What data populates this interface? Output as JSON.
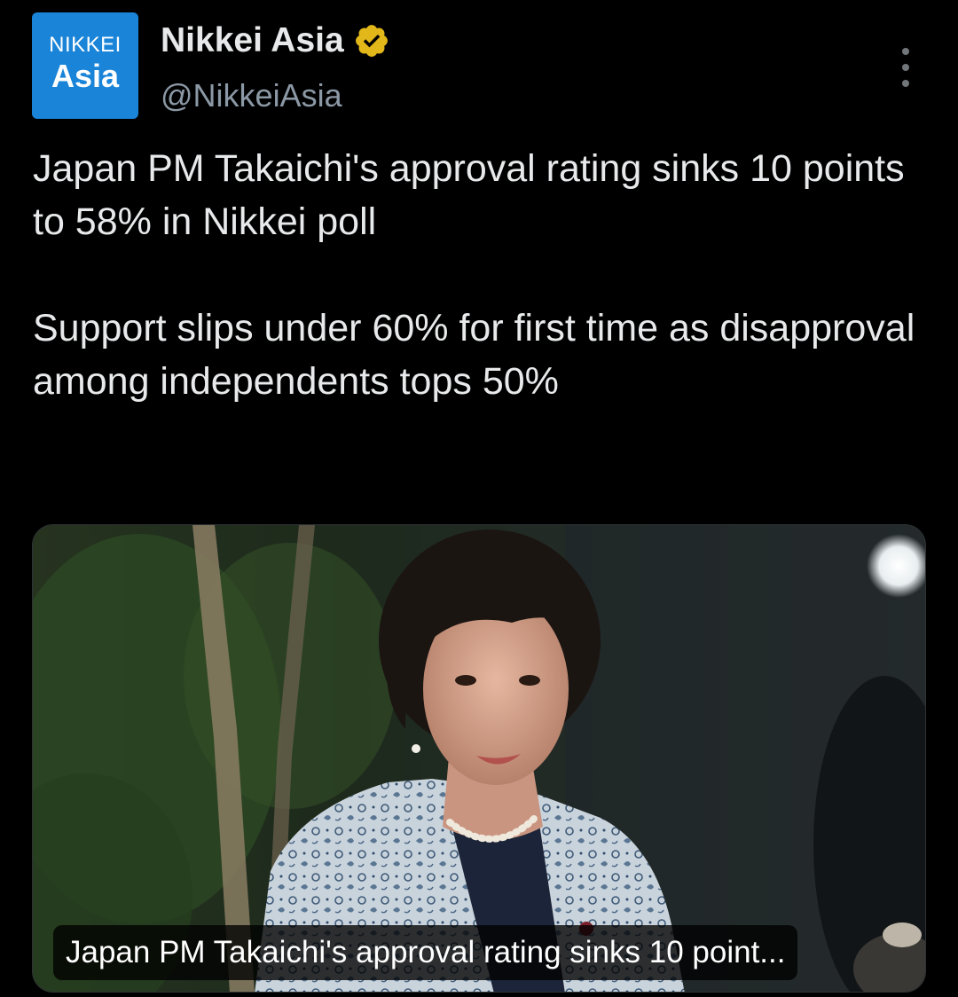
{
  "account": {
    "avatar_line1": "NIKKEI",
    "avatar_line2": "Asia",
    "display_name": "Nikkei Asia",
    "handle": "@NikkeiAsia",
    "verified": true
  },
  "tweet": {
    "headline": "Japan PM Takaichi's approval rating sinks 10 points to 58% in Nikkei poll",
    "subhead": "Support slips under 60% for first time as disapproval among independents tops 50%"
  },
  "card": {
    "caption": "Japan PM Takaichi's approval rating sinks 10 point..."
  },
  "icons": {
    "verified": "verified-badge-icon",
    "more": "more-options-icon"
  },
  "colors": {
    "background": "#000000",
    "text": "#e7e9ea",
    "secondary_text": "#8b98a5",
    "avatar_bg": "#1a84d8",
    "verified_gold": "#e2b719"
  }
}
